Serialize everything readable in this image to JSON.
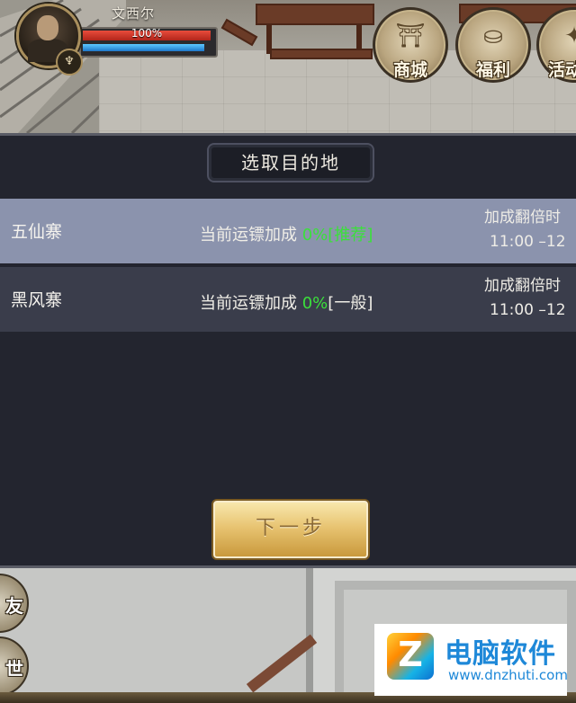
{
  "hud": {
    "player_name": "文西尔",
    "hp_text": "100%",
    "hp_fraction": 1.0,
    "mp_fraction": 0.95,
    "buttons": [
      {
        "label": "商城",
        "icon": "shop-icon"
      },
      {
        "label": "福利",
        "icon": "gold-ingot-icon"
      },
      {
        "label": "活动",
        "icon": "event-icon"
      }
    ]
  },
  "panel": {
    "title": "选取目的地",
    "destinations": [
      {
        "name": "五仙寨",
        "bonus_label": "当前运镖加成",
        "bonus_value": "0%",
        "tag": "[推荐]",
        "double_label": "加成翻倍时",
        "time": "11:00 –12",
        "selected": true
      },
      {
        "name": "黑风寨",
        "bonus_label": "当前运镖加成",
        "bonus_value": "0%",
        "tag": "[一般]",
        "double_label": "加成翻倍时",
        "time": "11:00 –12",
        "selected": false
      }
    ],
    "next_button": "下一步"
  },
  "side_buttons": [
    {
      "label": "友"
    },
    {
      "label": "世"
    }
  ],
  "watermark": {
    "logo_letter": "Z",
    "title": "电脑软件",
    "url": "www.dnzhuti.com"
  },
  "colors": {
    "selected_row": "#8b93ad",
    "normal_row": "#3a3d4b",
    "highlight_green": "#3be03b",
    "button_gold": "#e8c472"
  }
}
